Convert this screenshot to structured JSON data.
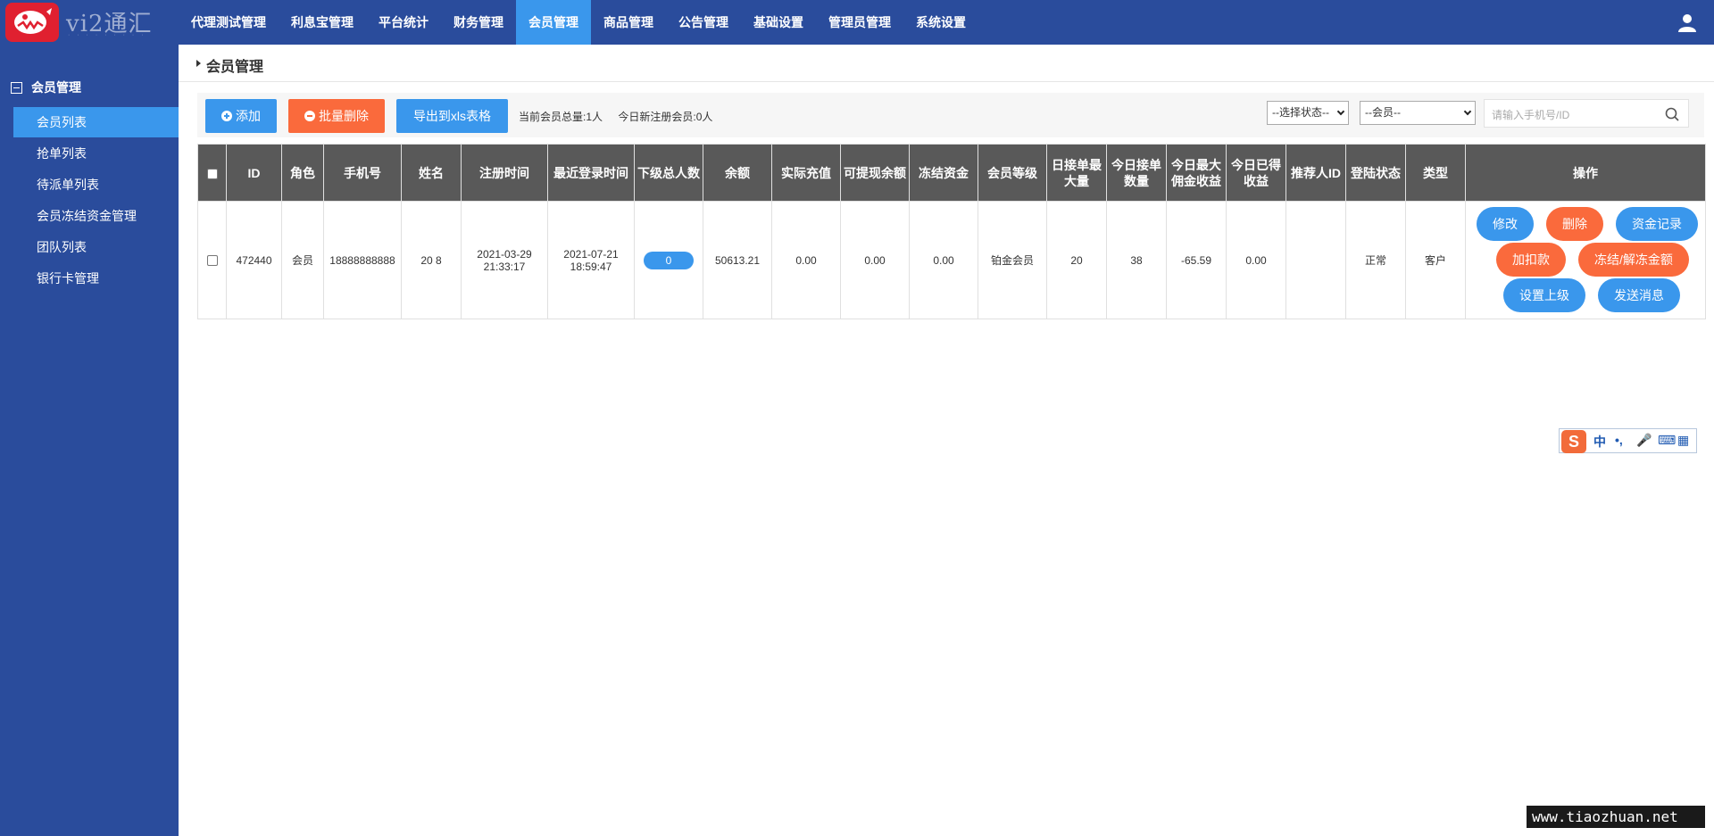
{
  "brand": {
    "name": "vi2通汇"
  },
  "nav": {
    "items": [
      {
        "label": "代理测试管理"
      },
      {
        "label": "利息宝管理"
      },
      {
        "label": "平台统计"
      },
      {
        "label": "财务管理"
      },
      {
        "label": "会员管理"
      },
      {
        "label": "商品管理"
      },
      {
        "label": "公告管理"
      },
      {
        "label": "基础设置"
      },
      {
        "label": "管理员管理"
      },
      {
        "label": "系统设置"
      }
    ],
    "active_index": 4
  },
  "sidebar": {
    "group_label": "会员管理",
    "items": [
      {
        "label": "会员列表"
      },
      {
        "label": "抢单列表"
      },
      {
        "label": "待派单列表"
      },
      {
        "label": "会员冻结资金管理"
      },
      {
        "label": "团队列表"
      },
      {
        "label": "银行卡管理"
      }
    ],
    "active_index": 0
  },
  "page": {
    "title": "会员管理"
  },
  "toolbar": {
    "add_label": "添加",
    "batch_delete_label": "批量删除",
    "export_label": "导出到xls表格",
    "total_members": "当前会员总量:1人",
    "new_today": "今日新注册会员:0人",
    "status_select": "--选择状态--",
    "member_select": "--会员--",
    "search_placeholder": "请输入手机号/ID"
  },
  "table": {
    "headers": [
      "ID",
      "角色",
      "手机号",
      "姓名",
      "注册时间",
      "最近登录时间",
      "下级总人数",
      "余额",
      "实际充值",
      "可提现余额",
      "冻结资金",
      "会员等级",
      "日接单最大量",
      "今日接单数量",
      "今日最大佣金收益",
      "今日已得收益",
      "推荐人ID",
      "登陆状态",
      "类型",
      "操作"
    ],
    "rows": [
      {
        "id": "472440",
        "role": "会员",
        "phone": "18888888888",
        "name": "20 8",
        "reg_date": "2021-03-29",
        "reg_time": "21:33:17",
        "login_date": "2021-07-21",
        "login_time": "18:59:47",
        "sub_count": "0",
        "balance": "50613.21",
        "recharge": "0.00",
        "withdrawable": "0.00",
        "frozen": "0.00",
        "level": "铂金会员",
        "daily_max": "20",
        "today_orders": "38",
        "today_max_comm": "-65.59",
        "today_earned": "0.00",
        "referrer": "",
        "login_status": "正常",
        "type": "客户"
      }
    ],
    "actions": {
      "edit": "修改",
      "delete": "删除",
      "fund_record": "资金记录",
      "adjust": "加扣款",
      "freeze": "冻结/解冻金额",
      "set_parent": "设置上级",
      "send_msg": "发送消息"
    }
  },
  "ime": {
    "s": "S",
    "zh": "中",
    "punct": "•,",
    "mic": "🎤",
    "kb": "⌨",
    "grid": "▦"
  },
  "watermark": "www.tiaozhuan.net",
  "colors": {
    "topbar": "#2a4c9c",
    "accent": "#3a97ec",
    "danger": "#fa6a3c",
    "table_header": "#595959"
  }
}
